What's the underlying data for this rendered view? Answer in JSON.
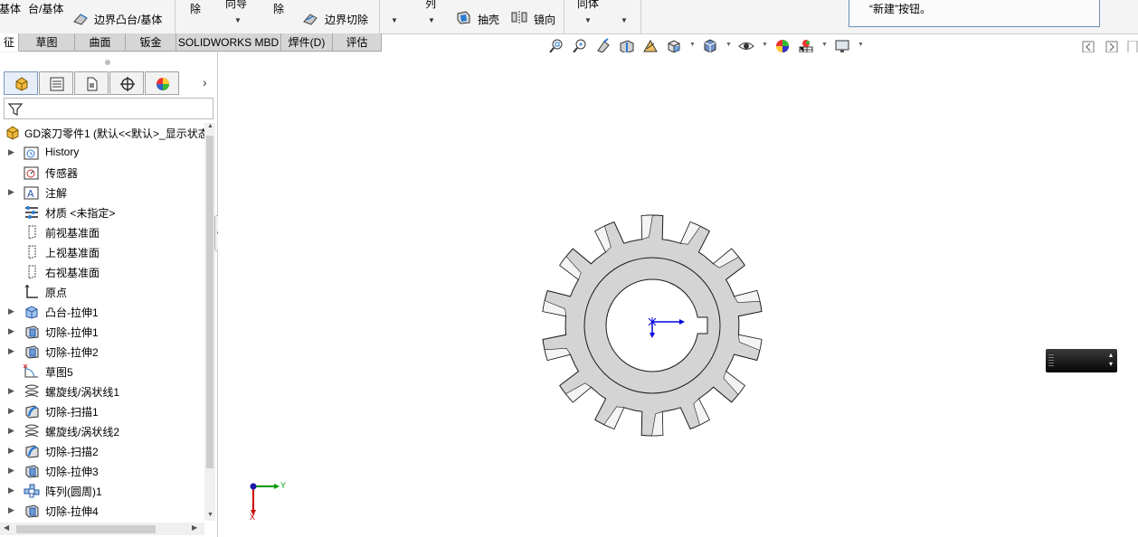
{
  "ribbon": {
    "items": [
      {
        "label": "基体"
      },
      {
        "label": "台/基体"
      },
      {
        "label": "边界凸台/基体"
      },
      {
        "label": "除"
      },
      {
        "label": "向导"
      },
      {
        "label": "除"
      },
      {
        "label": "边界切除"
      },
      {
        "label": "列"
      },
      {
        "label": "抽壳"
      },
      {
        "label": "镜向"
      },
      {
        "label": "同体"
      }
    ]
  },
  "tooltip": {
    "text": "“新建”按钮。"
  },
  "tabs": [
    {
      "label": "征",
      "active": true
    },
    {
      "label": "草图"
    },
    {
      "label": "曲面"
    },
    {
      "label": "钣金"
    },
    {
      "label": "SOLIDWORKS MBD"
    },
    {
      "label": "焊件(D)"
    },
    {
      "label": "评估"
    }
  ],
  "hud": {
    "icons": [
      "zoom-to-fit-icon",
      "zoom-area-icon",
      "previous-view-icon",
      "section-view-icon",
      "dynamic-annotation-icon",
      "view-orientation-icon",
      "display-style-icon",
      "hide-show-icon",
      "edit-appearance-icon",
      "apply-scene-icon",
      "view-settings-icon"
    ]
  },
  "panel": {
    "tab_icons": [
      "feature-manager-icon",
      "property-manager-icon",
      "configuration-manager-icon",
      "dimxpert-icon",
      "display-manager-icon"
    ],
    "more": "›"
  },
  "tree": {
    "root": "GD滚刀零件1 (默认<<默认>_显示状态",
    "items": [
      {
        "label": "History",
        "icon": "history-icon",
        "expandable": true
      },
      {
        "label": "传感器",
        "icon": "sensor-icon",
        "expandable": false
      },
      {
        "label": "注解",
        "icon": "annotation-icon",
        "expandable": true
      },
      {
        "label": "材质 <未指定>",
        "icon": "material-icon",
        "expandable": false
      },
      {
        "label": "前视基准面",
        "icon": "plane-icon",
        "expandable": false
      },
      {
        "label": "上视基准面",
        "icon": "plane-icon",
        "expandable": false
      },
      {
        "label": "右视基准面",
        "icon": "plane-icon",
        "expandable": false
      },
      {
        "label": "原点",
        "icon": "origin-icon",
        "expandable": false
      },
      {
        "label": "凸台-拉伸1",
        "icon": "boss-extrude-icon",
        "expandable": true
      },
      {
        "label": "切除-拉伸1",
        "icon": "cut-extrude-icon",
        "expandable": true
      },
      {
        "label": "切除-拉伸2",
        "icon": "cut-extrude-icon",
        "expandable": true
      },
      {
        "label": "草图5",
        "icon": "sketch-icon",
        "expandable": false
      },
      {
        "label": "螺旋线/涡状线1",
        "icon": "helix-icon",
        "expandable": true
      },
      {
        "label": "切除-扫描1",
        "icon": "cut-sweep-icon",
        "expandable": true
      },
      {
        "label": "螺旋线/涡状线2",
        "icon": "helix-icon",
        "expandable": true
      },
      {
        "label": "切除-扫描2",
        "icon": "cut-sweep-icon",
        "expandable": true
      },
      {
        "label": "切除-拉伸3",
        "icon": "cut-extrude-icon",
        "expandable": true
      },
      {
        "label": "阵列(圆周)1",
        "icon": "circular-pattern-icon",
        "expandable": true
      },
      {
        "label": "切除-拉伸4",
        "icon": "cut-extrude-icon",
        "expandable": true
      }
    ]
  },
  "triad": {
    "x_label": "X",
    "y_label": "Y"
  },
  "colors": {
    "part_fill": "#d4d4d4",
    "part_edge": "#1a1a1a",
    "triad_x": "#cc0000",
    "triad_y": "#009900",
    "origin": "#0000dd"
  }
}
